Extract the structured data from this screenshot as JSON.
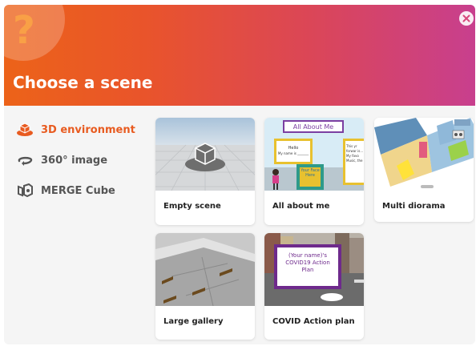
{
  "header": {
    "title": "Choose a scene"
  },
  "sidebar": {
    "items": [
      {
        "label": "3D environment",
        "icon": "3d-cube-icon",
        "active": true
      },
      {
        "label": "360° image",
        "icon": "360-icon",
        "active": false
      },
      {
        "label": "MERGE Cube",
        "icon": "merge-cube-icon",
        "active": false
      }
    ]
  },
  "scenes": [
    {
      "label": "Empty scene"
    },
    {
      "label": "All about me",
      "thumb_text": {
        "banner": "All About Me",
        "hello": "Hello",
        "name": "My name is _______",
        "face": "Your Face Here",
        "side": "This yr forwar is... My favo Music, the"
      }
    },
    {
      "label": "Multi diorama"
    },
    {
      "label": "Large gallery"
    },
    {
      "label": "COVID Action plan",
      "thumb_text": {
        "sign": "(Your name)'s COVID19 Action Plan"
      }
    }
  ],
  "colors": {
    "accent": "#e85b20",
    "gradient_start": "#ec6319",
    "gradient_end": "#c83f8e"
  }
}
